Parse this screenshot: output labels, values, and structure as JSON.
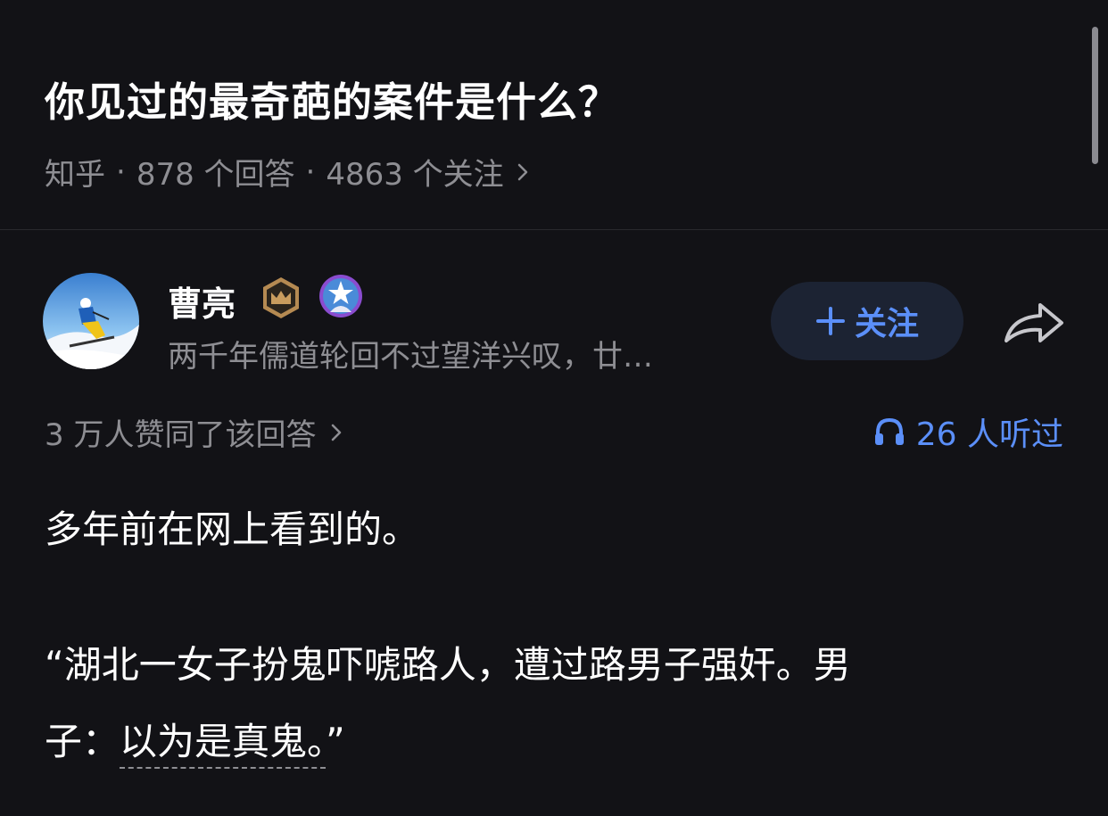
{
  "question": {
    "title": "你见过的最奇葩的案件是什么？",
    "source": "知乎",
    "separator": "·",
    "answers_count": "878 个回答",
    "followers_count": "4863 个关注"
  },
  "author": {
    "name": "曹亮",
    "bio": "两千年儒道轮回不过望洋兴叹，廿…",
    "follow_label": "关注",
    "badges": [
      "crown-badge-icon",
      "star-badge-icon"
    ]
  },
  "answer": {
    "upvote_text": "3 万人赞同了该回答",
    "listen_text": "26 人听过",
    "paragraph_1": "多年前在网上看到的。",
    "paragraph_2": "“湖北一女子扮鬼吓唬路人，遭过路男子强奸。男",
    "paragraph_3_prefix": "子：",
    "paragraph_3_highlight": "以为是真鬼。",
    "paragraph_3_suffix": "”"
  },
  "colors": {
    "background": "#121216",
    "accent": "#5b8ff9",
    "muted_text": "#8e8e93",
    "follow_button_bg": "#1c2333",
    "crown_badge": "#b58a52",
    "star_badge": "#8a4ccf"
  }
}
